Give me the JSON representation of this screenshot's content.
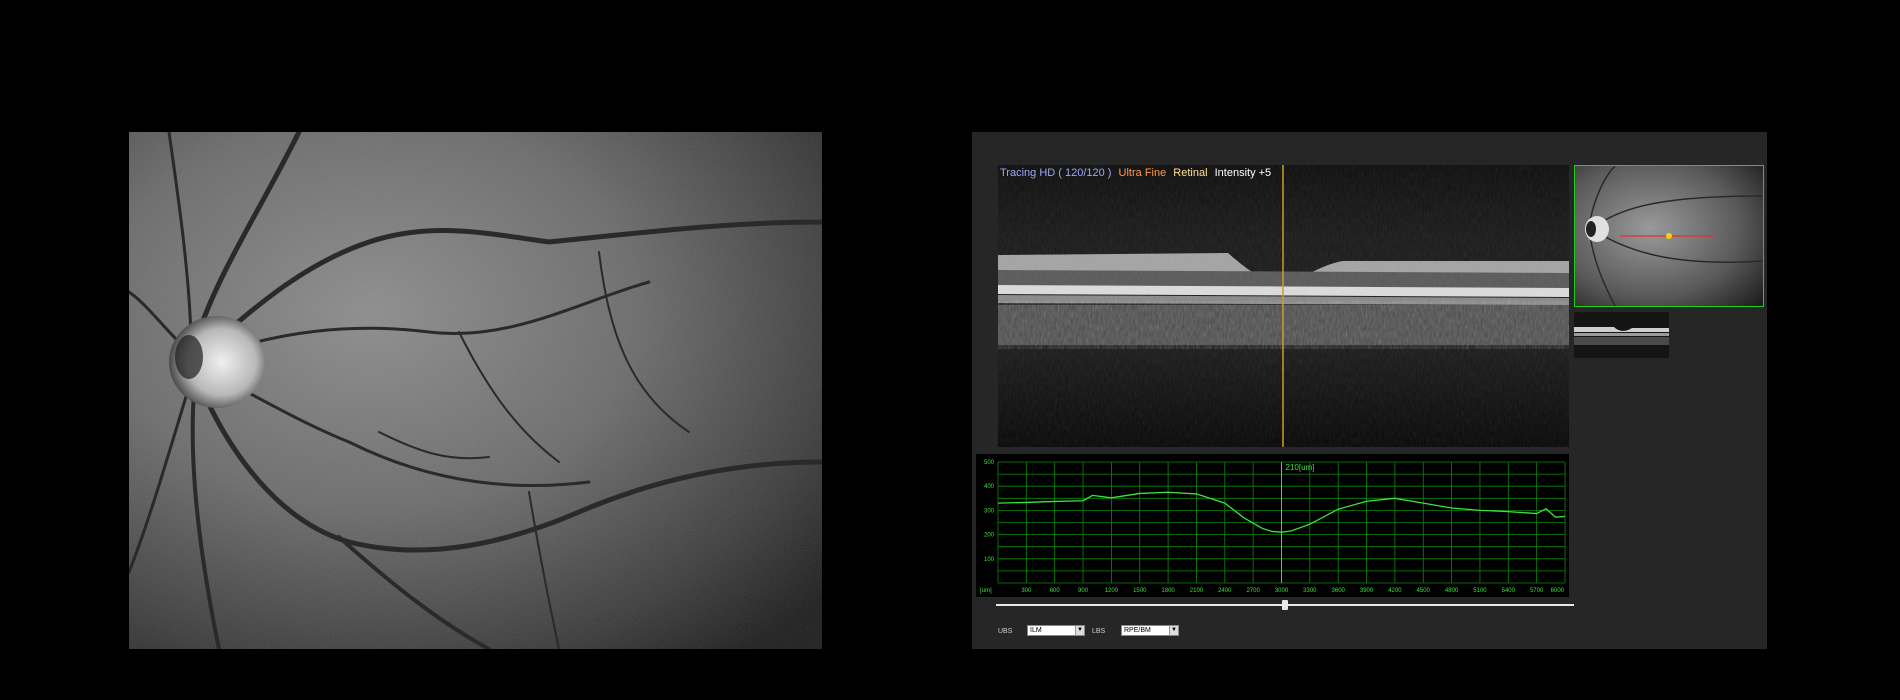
{
  "fundus": {
    "description_icon": "fundus-photo"
  },
  "bscan": {
    "mode": "Tracing HD ( 120/120 )",
    "quality": "Ultra Fine",
    "layer": "Retinal",
    "intensity": "Intensity +5"
  },
  "graph": {
    "cursor_label": "210[um]",
    "x_unit": "[um]",
    "y_ticks": [
      "500",
      "400",
      "300",
      "200",
      "100"
    ],
    "x_ticks": [
      "300",
      "600",
      "900",
      "1200",
      "1500",
      "1800",
      "2100",
      "2400",
      "2700",
      "3000",
      "3300",
      "3600",
      "3900",
      "4200",
      "4500",
      "4800",
      "5100",
      "5400",
      "5700",
      "6000"
    ]
  },
  "chart_data": {
    "type": "line",
    "title": "",
    "xlabel": "[um]",
    "ylabel": "",
    "xlim": [
      0,
      6000
    ],
    "ylim": [
      0,
      500
    ],
    "grid": true,
    "series": [
      {
        "x": [
          0,
          300,
          600,
          900,
          1000,
          1200,
          1500,
          1800,
          2100,
          2400,
          2600,
          2800,
          2900,
          3000,
          3100,
          3300,
          3600,
          3900,
          4200,
          4500,
          4800,
          5100,
          5400,
          5700,
          5800,
          5900,
          6000
        ],
        "values": [
          330,
          333,
          337,
          340,
          362,
          352,
          370,
          375,
          368,
          330,
          270,
          225,
          213,
          210,
          215,
          243,
          305,
          338,
          350,
          330,
          310,
          300,
          295,
          287,
          307,
          272,
          275
        ]
      }
    ],
    "cursor_x": 3000,
    "cursor_value": 210
  },
  "controls": {
    "ubs_label": "UBS",
    "ubs_value": "ILM",
    "lbs_label": "LBS",
    "lbs_value": "RPE/BM"
  },
  "colors": {
    "graph_line": "#3de23d",
    "grid": "#0b8a0b",
    "cursor": "#c8a020",
    "thumb_border": "#19d219"
  }
}
